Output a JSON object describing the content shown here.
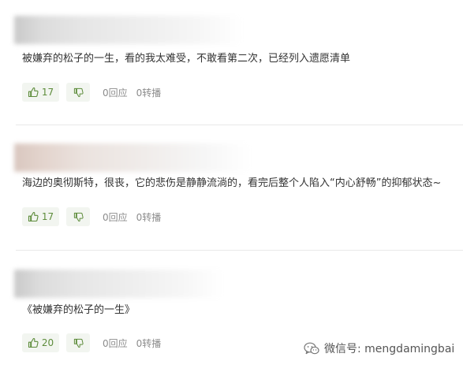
{
  "comments": [
    {
      "text": "被嫌弃的松子的一生，看的我太难受，不敢看第二次，已经列入遗愿清单",
      "likes": "17",
      "replies": "0回应",
      "shares": "0转播"
    },
    {
      "text": "海边的奥彻斯特，很丧，它的悲伤是静静流淌的，看完后整个人陷入“内心舒畅”的抑郁状态~",
      "likes": "17",
      "replies": "0回应",
      "shares": "0转播"
    },
    {
      "text": "《被嫌弃的松子的一生》",
      "likes": "20",
      "replies": "0回应",
      "shares": "0转播"
    }
  ],
  "watermark": {
    "text": "微信号: mengdamingbai",
    "icon": "wechat-icon"
  },
  "colors": {
    "like_green": "#5d8c3b",
    "button_bg": "#f2f5f0",
    "meta_gray": "#8c8c8c",
    "divider": "#e9e9e9"
  }
}
